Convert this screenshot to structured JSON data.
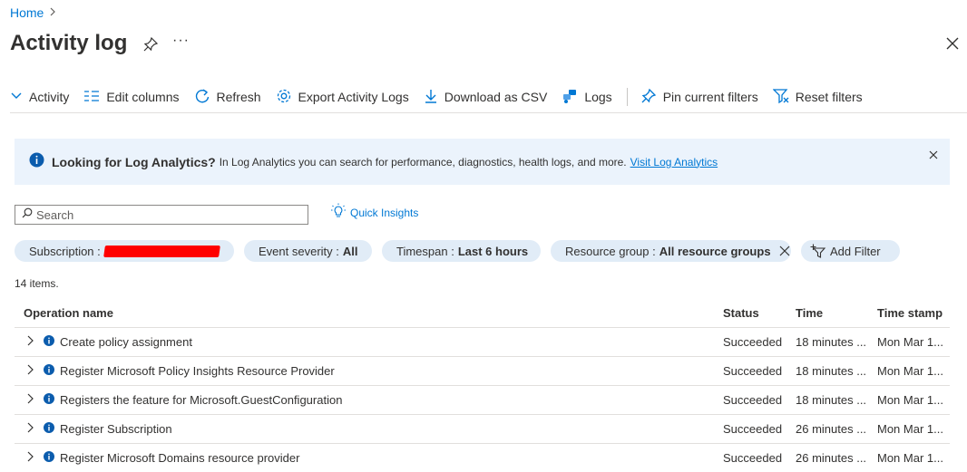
{
  "breadcrumb": {
    "home": "Home"
  },
  "page": {
    "title": "Activity log",
    "more": "···"
  },
  "toolbar": {
    "activity": "Activity",
    "edit_columns": "Edit columns",
    "refresh": "Refresh",
    "export": "Export Activity Logs",
    "download": "Download as CSV",
    "logs": "Logs",
    "pin_filters": "Pin current filters",
    "reset_filters": "Reset filters"
  },
  "banner": {
    "bold": "Looking for Log Analytics?",
    "text": "In Log Analytics you can search for performance, diagnostics, health logs, and more.",
    "link": "Visit Log Analytics"
  },
  "search": {
    "placeholder": "Search"
  },
  "quick_insights": "Quick Insights",
  "filters": {
    "subscription_label": "Subscription :",
    "severity_label": "Event severity :",
    "severity_value": "All",
    "timespan_label": "Timespan :",
    "timespan_value": "Last 6 hours",
    "rg_label": "Resource group :",
    "rg_value": "All resource groups",
    "add_filter": "Add Filter"
  },
  "count": "14 items.",
  "table": {
    "headers": {
      "op": "Operation name",
      "status": "Status",
      "time": "Time",
      "stamp": "Time stamp"
    },
    "rows": [
      {
        "op": "Create policy assignment",
        "status": "Succeeded",
        "time": "18 minutes ...",
        "stamp": "Mon Mar 1..."
      },
      {
        "op": "Register Microsoft Policy Insights Resource Provider",
        "status": "Succeeded",
        "time": "18 minutes ...",
        "stamp": "Mon Mar 1..."
      },
      {
        "op": "Registers the feature for Microsoft.GuestConfiguration",
        "status": "Succeeded",
        "time": "18 minutes ...",
        "stamp": "Mon Mar 1..."
      },
      {
        "op": "Register Subscription",
        "status": "Succeeded",
        "time": "26 minutes ...",
        "stamp": "Mon Mar 1..."
      },
      {
        "op": "Register Microsoft Domains resource provider",
        "status": "Succeeded",
        "time": "26 minutes ...",
        "stamp": "Mon Mar 1..."
      }
    ]
  },
  "colors": {
    "accent": "#0078d4",
    "pill_bg": "#e1ecf7",
    "banner_bg": "#ebf3fc",
    "redaction": "#ff0000"
  },
  "icons": [
    "chevron-right-icon",
    "pin-icon",
    "close-icon",
    "chevron-down-icon",
    "columns-icon",
    "refresh-icon",
    "gear-icon",
    "download-icon",
    "logs-icon",
    "pin-icon",
    "filter-reset-icon",
    "info-icon",
    "search-icon",
    "lightbulb-icon",
    "add-filter-icon"
  ]
}
